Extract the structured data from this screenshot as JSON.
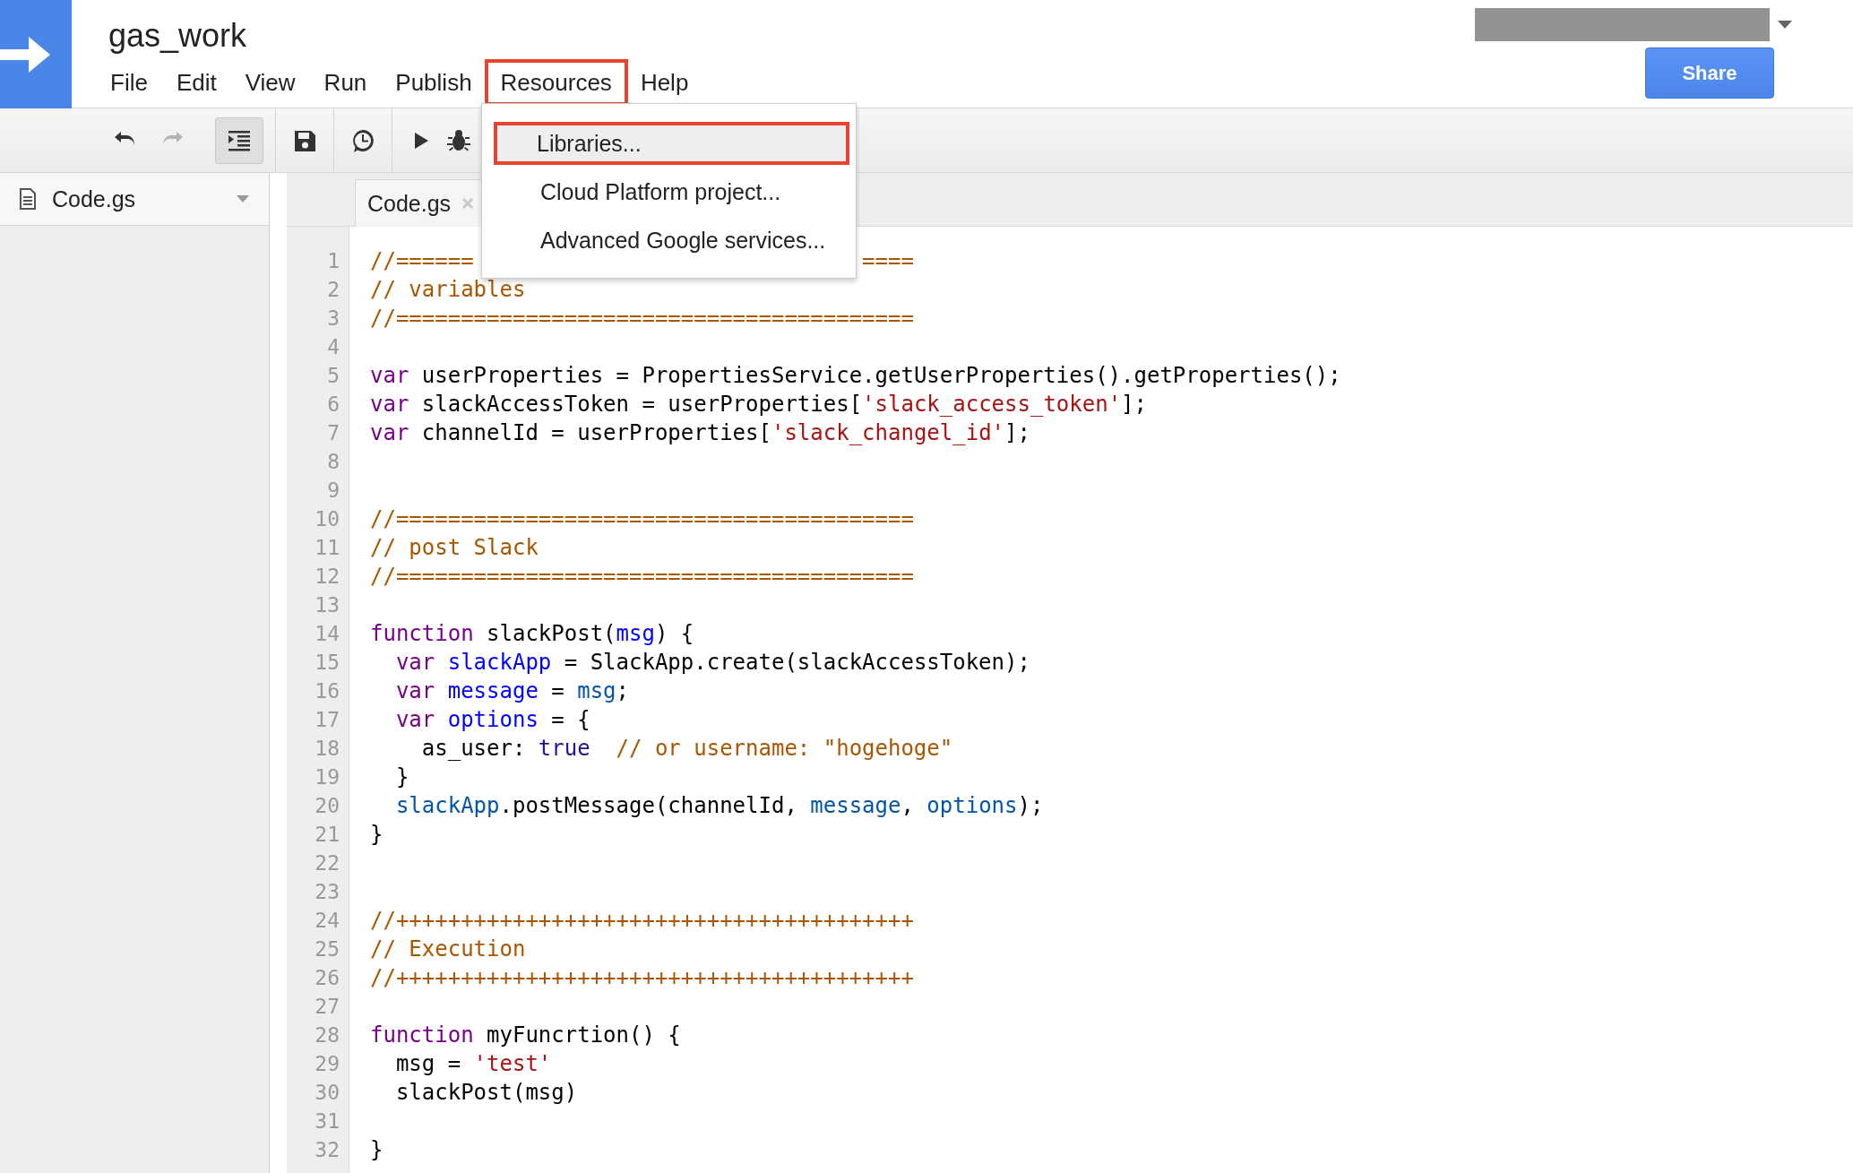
{
  "app": {
    "title": "gas_work"
  },
  "menu_bar": [
    {
      "label": "File",
      "outlined": false
    },
    {
      "label": "Edit",
      "outlined": false
    },
    {
      "label": "View",
      "outlined": false
    },
    {
      "label": "Run",
      "outlined": false
    },
    {
      "label": "Publish",
      "outlined": false
    },
    {
      "label": "Resources",
      "outlined": true
    },
    {
      "label": "Help",
      "outlined": false
    }
  ],
  "share_button": {
    "label": "Share"
  },
  "toolbar": [
    {
      "kind": "undo",
      "disabled": false,
      "pressed": false
    },
    {
      "kind": "redo",
      "disabled": true,
      "pressed": false
    },
    {
      "kind": "indent",
      "disabled": false,
      "pressed": true
    },
    {
      "kind": "save",
      "disabled": false,
      "pressed": false
    },
    {
      "kind": "triggers",
      "disabled": false,
      "pressed": false
    },
    {
      "kind": "run",
      "disabled": false,
      "pressed": false
    },
    {
      "kind": "debug",
      "disabled": false,
      "pressed": false
    }
  ],
  "sidebar": {
    "files": [
      {
        "name": "Code.gs"
      }
    ]
  },
  "editor": {
    "tabs": [
      {
        "label": "Code.gs",
        "selected": true
      }
    ],
    "lines": [
      {
        "number": "1",
        "tokens": [
          {
            "kind": "comment",
            "text": "//======                              ===="
          }
        ]
      },
      {
        "number": "2",
        "tokens": [
          {
            "kind": "comment",
            "text": "// variables"
          }
        ]
      },
      {
        "number": "3",
        "tokens": [
          {
            "kind": "comment",
            "text": "//========================================"
          }
        ]
      },
      {
        "number": "4"
      },
      {
        "number": "5",
        "tokens": [
          {
            "kind": "keyword",
            "text": "var"
          },
          {
            "kind": "plain",
            "text": " userProperties = PropertiesService.getUserProperties().getProperties();"
          }
        ]
      },
      {
        "number": "6",
        "tokens": [
          {
            "kind": "keyword",
            "text": "var"
          },
          {
            "kind": "plain",
            "text": " slackAccessToken = userProperties["
          },
          {
            "kind": "string",
            "text": "'slack_access_token'"
          },
          {
            "kind": "plain",
            "text": "];"
          }
        ]
      },
      {
        "number": "7",
        "tokens": [
          {
            "kind": "keyword",
            "text": "var"
          },
          {
            "kind": "plain",
            "text": " channelId = userProperties["
          },
          {
            "kind": "string",
            "text": "'slack_changel_id'"
          },
          {
            "kind": "plain",
            "text": "];"
          }
        ]
      },
      {
        "number": "8"
      },
      {
        "number": "9"
      },
      {
        "number": "10",
        "tokens": [
          {
            "kind": "comment",
            "text": "//========================================"
          }
        ]
      },
      {
        "number": "11",
        "tokens": [
          {
            "kind": "comment",
            "text": "// post Slack"
          }
        ]
      },
      {
        "number": "12",
        "tokens": [
          {
            "kind": "comment",
            "text": "//========================================"
          }
        ]
      },
      {
        "number": "13"
      },
      {
        "number": "14",
        "tokens": [
          {
            "kind": "keyword",
            "text": "function"
          },
          {
            "kind": "plain",
            "text": " slackPost("
          },
          {
            "kind": "def",
            "text": "msg"
          },
          {
            "kind": "plain",
            "text": ") {"
          }
        ]
      },
      {
        "number": "15",
        "tokens": [
          {
            "kind": "keyword",
            "text": "  var "
          },
          {
            "kind": "def",
            "text": "slackApp"
          },
          {
            "kind": "plain",
            "text": " = SlackApp.create(slackAccessToken);"
          }
        ]
      },
      {
        "number": "16",
        "tokens": [
          {
            "kind": "keyword",
            "text": "  var "
          },
          {
            "kind": "def",
            "text": "message"
          },
          {
            "kind": "plain",
            "text": " = "
          },
          {
            "kind": "variable",
            "text": "msg"
          },
          {
            "kind": "plain",
            "text": ";"
          }
        ]
      },
      {
        "number": "17",
        "tokens": [
          {
            "kind": "keyword",
            "text": "  var "
          },
          {
            "kind": "def",
            "text": "options"
          },
          {
            "kind": "plain",
            "text": " = {"
          }
        ]
      },
      {
        "number": "18",
        "tokens": [
          {
            "kind": "plain",
            "text": "    as_user: "
          },
          {
            "kind": "atom",
            "text": "true"
          },
          {
            "kind": "comment",
            "text": "  // or username: \"hogehoge\""
          }
        ]
      },
      {
        "number": "19",
        "tokens": [
          {
            "kind": "plain",
            "text": "  }"
          }
        ]
      },
      {
        "number": "20",
        "tokens": [
          {
            "kind": "variable",
            "text": "  slackApp"
          },
          {
            "kind": "plain",
            "text": ".postMessage(channelId, "
          },
          {
            "kind": "variable",
            "text": "message"
          },
          {
            "kind": "plain",
            "text": ", "
          },
          {
            "kind": "variable",
            "text": "options"
          },
          {
            "kind": "plain",
            "text": ");"
          }
        ]
      },
      {
        "number": "21",
        "tokens": [
          {
            "kind": "plain",
            "text": "}"
          }
        ]
      },
      {
        "number": "22"
      },
      {
        "number": "23"
      },
      {
        "number": "24",
        "tokens": [
          {
            "kind": "comment",
            "text": "//++++++++++++++++++++++++++++++++++++++++"
          }
        ]
      },
      {
        "number": "25",
        "tokens": [
          {
            "kind": "comment",
            "text": "// Execution"
          }
        ]
      },
      {
        "number": "26",
        "tokens": [
          {
            "kind": "comment",
            "text": "//++++++++++++++++++++++++++++++++++++++++"
          }
        ]
      },
      {
        "number": "27"
      },
      {
        "number": "28",
        "tokens": [
          {
            "kind": "keyword",
            "text": "function"
          },
          {
            "kind": "plain",
            "text": " myFuncrtion() {"
          }
        ]
      },
      {
        "number": "29",
        "tokens": [
          {
            "kind": "plain",
            "text": "  msg = "
          },
          {
            "kind": "string",
            "text": "'test'"
          }
        ]
      },
      {
        "number": "30",
        "tokens": [
          {
            "kind": "plain",
            "text": "  slackPost(msg)"
          }
        ]
      },
      {
        "number": "31"
      },
      {
        "number": "32",
        "tokens": [
          {
            "kind": "plain",
            "text": "}"
          }
        ]
      }
    ]
  },
  "dropdown": {
    "items": [
      {
        "label": "Libraries...",
        "selected": true,
        "outlined": true
      },
      {
        "label": "Cloud Platform project...",
        "selected": false,
        "outlined": false
      },
      {
        "label": "Advanced Google services...",
        "selected": false,
        "outlined": false
      }
    ]
  }
}
